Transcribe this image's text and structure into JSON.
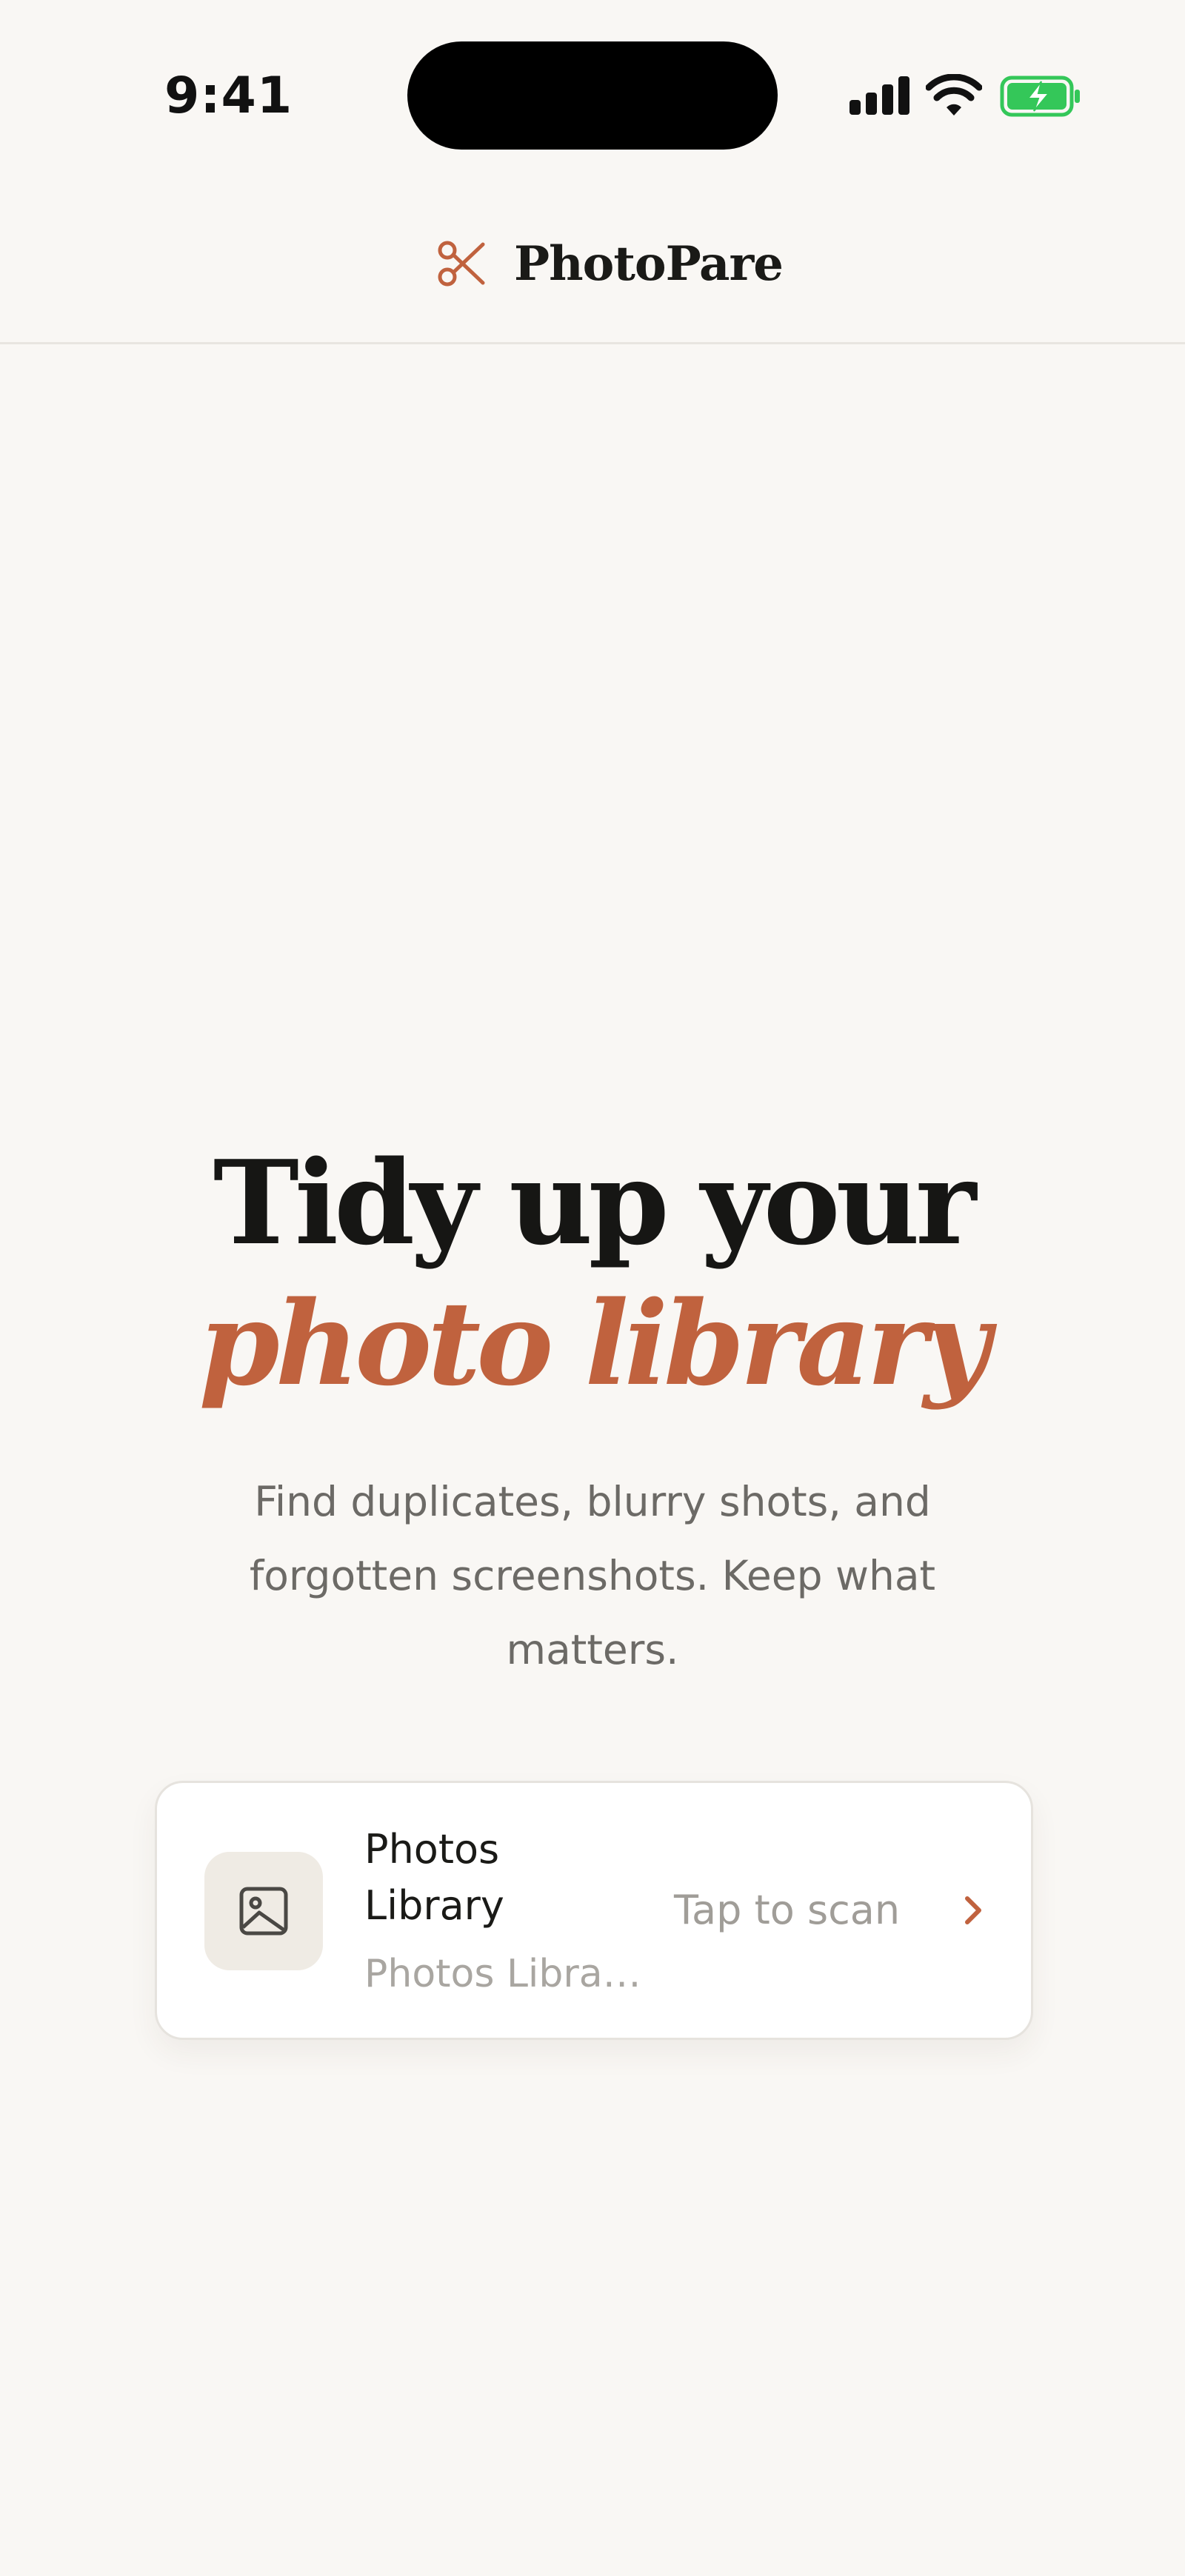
{
  "status_bar": {
    "time": "9:41"
  },
  "header": {
    "app_name": "PhotoPare",
    "icon": "scissors-icon"
  },
  "hero": {
    "title_line1": "Tidy up your",
    "title_line2": "photo library",
    "subtitle": "Find duplicates, blurry shots, and forgotten screenshots. Keep what matters."
  },
  "library_card": {
    "title": "Photos Library",
    "subtitle": "Photos Libra…",
    "action_label": "Tap to scan",
    "icon": "image-icon",
    "chevron_icon": "chevron-right-icon"
  },
  "colors": {
    "background": "#f9f7f4",
    "accent": "#c0623e",
    "text_primary": "#161614",
    "text_secondary": "#6c6a66",
    "battery_green": "#34c759"
  }
}
